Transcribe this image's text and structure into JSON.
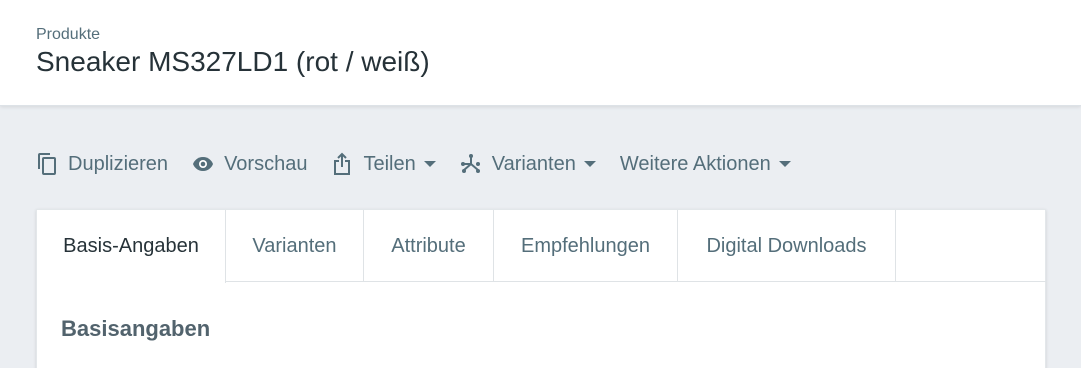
{
  "header": {
    "breadcrumb": "Produkte",
    "title": "Sneaker MS327LD1 (rot / weiß)"
  },
  "toolbar": {
    "actions": [
      {
        "label": "Duplizieren",
        "icon": "copy-icon",
        "dropdown": false
      },
      {
        "label": "Vorschau",
        "icon": "eye-icon",
        "dropdown": false
      },
      {
        "label": "Teilen",
        "icon": "share-icon",
        "dropdown": true
      },
      {
        "label": "Varianten",
        "icon": "variants-icon",
        "dropdown": true
      },
      {
        "label": "Weitere Aktionen",
        "icon": "",
        "dropdown": true
      }
    ]
  },
  "tabs": [
    {
      "label": "Basis-Angaben",
      "active": true
    },
    {
      "label": "Varianten",
      "active": false
    },
    {
      "label": "Attribute",
      "active": false
    },
    {
      "label": "Empfehlungen",
      "active": false
    },
    {
      "label": "Digital Downloads",
      "active": false
    }
  ],
  "section": {
    "title": "Basisangaben"
  },
  "colors": {
    "background": "#ebeef2",
    "text_primary": "#263238",
    "text_secondary": "#546e7a"
  }
}
